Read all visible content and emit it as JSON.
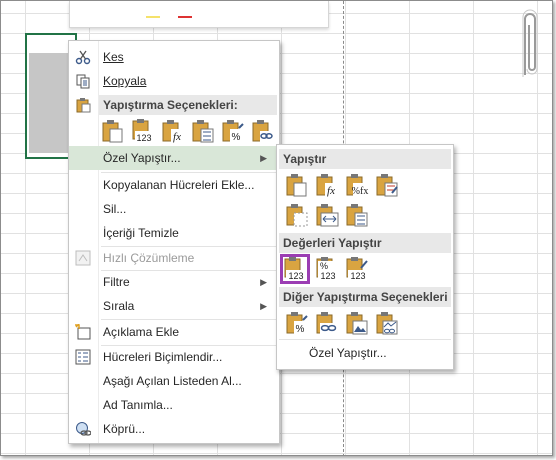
{
  "context_menu": {
    "cut": "Kes",
    "copy": "Kopyala",
    "paste_options_header": "Yapıştırma Seçenekleri:",
    "paste_special": "Özel Yapıştır...",
    "insert_copied": "Kopyalanan Hücreleri Ekle...",
    "delete": "Sil...",
    "clear_contents": "İçeriği Temizle",
    "quick_analysis": "Hızlı Çözümleme",
    "filter": "Filtre",
    "sort": "Sırala",
    "add_comment": "Açıklama Ekle",
    "format_cells": "Hücreleri Biçimlendir...",
    "pick_from_list": "Aşağı Açılan Listeden Al...",
    "define_name": "Ad Tanımla...",
    "hyperlink": "Köprü..."
  },
  "submenu": {
    "paste_header": "Yapıştır",
    "paste_values_header": "Değerleri Yapıştır",
    "other_paste_header": "Diğer Yapıştırma Seçenekleri",
    "paste_special_link": "Özel Yapıştır..."
  },
  "icons": {
    "cut": "scissors-icon",
    "copy": "copy-icon",
    "paste": "clipboard-icon"
  },
  "colors": {
    "highlight": "#d9e7d8",
    "selected_outline": "#9b3db3",
    "selection_border": "#217346"
  }
}
